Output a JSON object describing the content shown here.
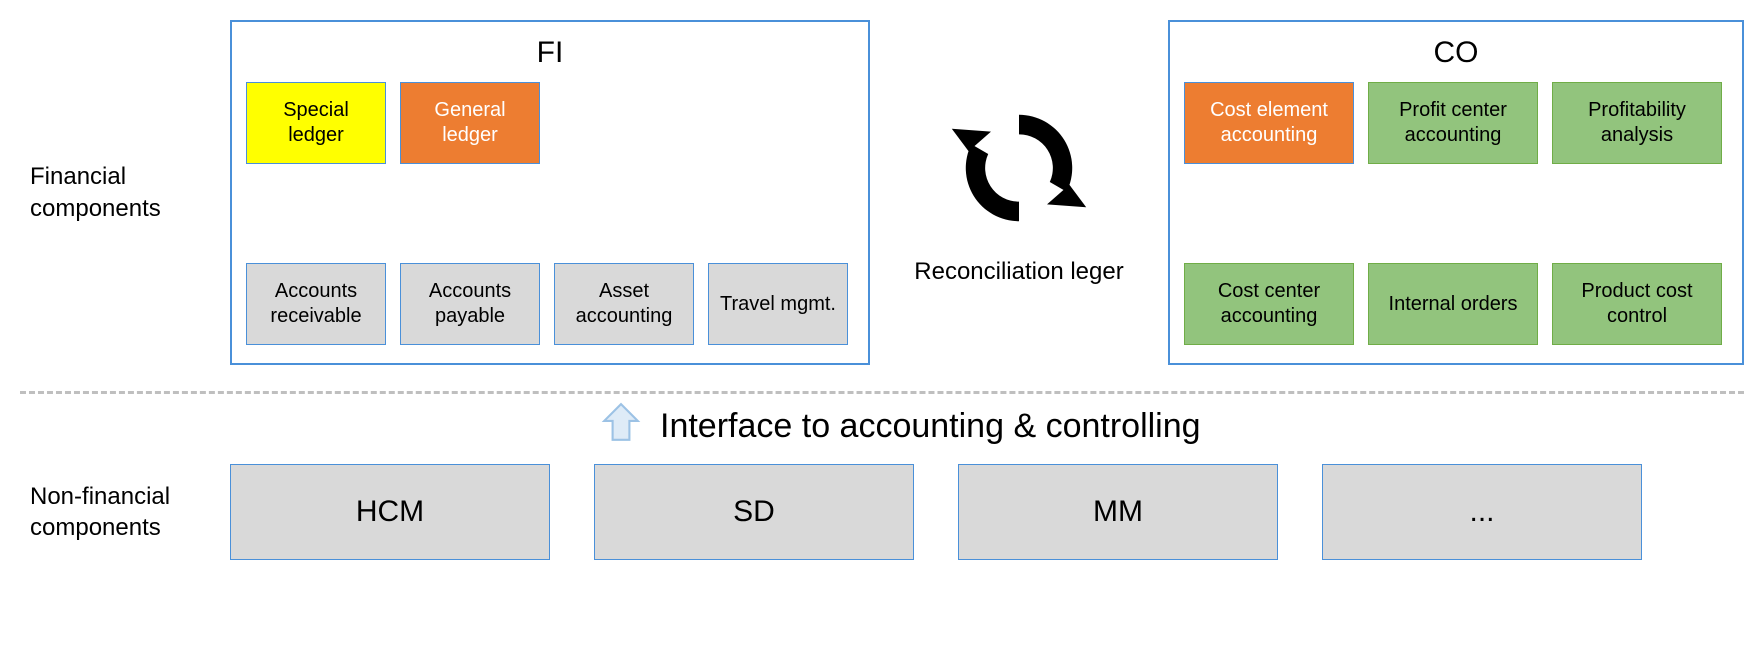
{
  "labels": {
    "financial": "Financial components",
    "nonfinancial": "Non-financial components",
    "interface": "Interface to accounting & controlling",
    "reconciliation": "Reconciliation leger"
  },
  "fi": {
    "title": "FI",
    "top": [
      {
        "label": "Special ledger",
        "style": "yellow"
      },
      {
        "label": "General ledger",
        "style": "orange"
      }
    ],
    "bottom": [
      {
        "label": "Accounts receivable"
      },
      {
        "label": "Accounts payable"
      },
      {
        "label": "Asset accounting"
      },
      {
        "label": "Travel mgmt."
      }
    ]
  },
  "co": {
    "title": "CO",
    "top": [
      {
        "label": "Cost element accounting",
        "style": "orange"
      },
      {
        "label": "Profit center accounting",
        "style": "green"
      },
      {
        "label": "Profitability analysis",
        "style": "green"
      }
    ],
    "bottom": [
      {
        "label": "Cost center accounting"
      },
      {
        "label": "Internal orders"
      },
      {
        "label": "Product cost control"
      }
    ]
  },
  "nonfinancial_modules": [
    "HCM",
    "SD",
    "MM",
    "..."
  ]
}
